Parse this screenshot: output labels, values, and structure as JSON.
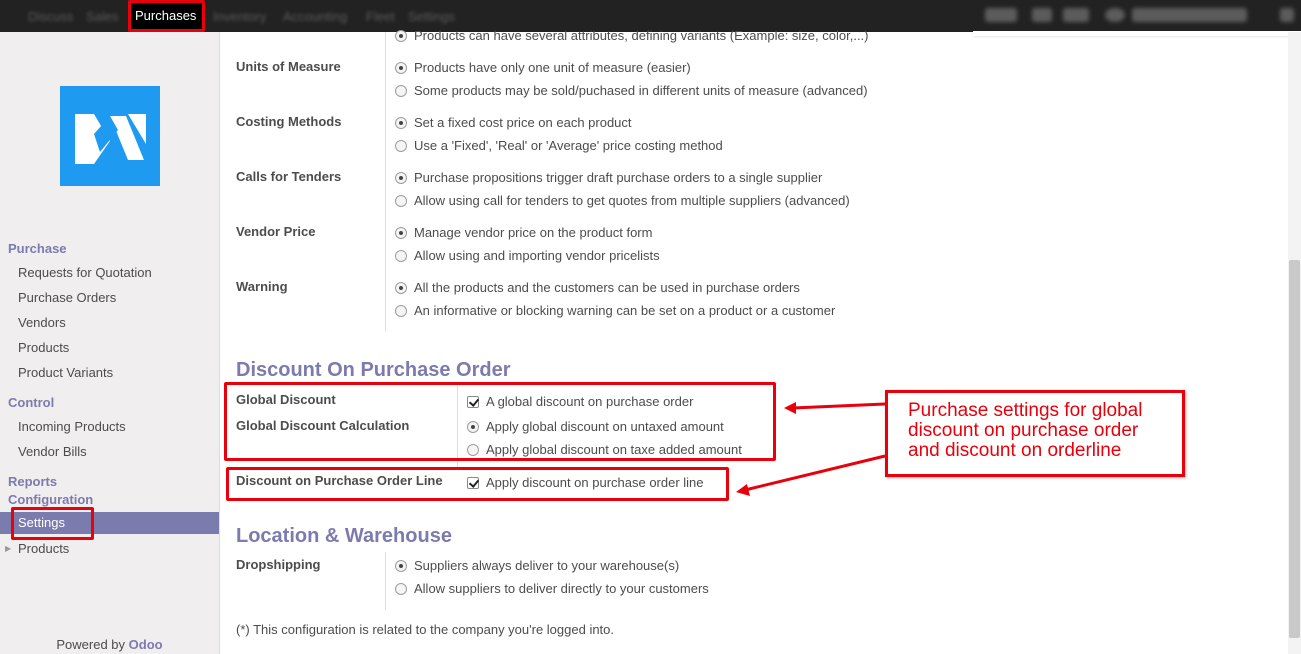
{
  "topbar": {
    "active_menu": "Purchases",
    "menu_blurred": [
      "Discuss",
      "Sales",
      "Inventory",
      "Accounting",
      "Fleet",
      "Settings"
    ]
  },
  "sidebar": {
    "sections": [
      {
        "title": "Purchase",
        "items": [
          "Requests for Quotation",
          "Purchase Orders",
          "Vendors",
          "Products",
          "Product Variants"
        ]
      },
      {
        "title": "Control",
        "items": [
          "Incoming Products",
          "Vendor Bills"
        ]
      },
      {
        "title": "Reports",
        "items": []
      },
      {
        "title": "Configuration",
        "items": [
          "Settings",
          "Products"
        ]
      }
    ],
    "powered_by": "Powered by",
    "brand": "Odoo"
  },
  "settings": {
    "variants_option": "Products can have several attributes, defining variants (Example: size, color,...)",
    "units": {
      "label": "Units of Measure",
      "options": [
        "Products have only one unit of measure (easier)",
        "Some products may be sold/puchased in different units of measure (advanced)"
      ],
      "selected": 0
    },
    "costing": {
      "label": "Costing Methods",
      "options": [
        "Set a fixed cost price on each product",
        "Use a 'Fixed', 'Real' or 'Average' price costing method"
      ],
      "selected": 0
    },
    "tenders": {
      "label": "Calls for Tenders",
      "options": [
        "Purchase propositions trigger draft purchase orders to a single supplier",
        "Allow using call for tenders to get quotes from multiple suppliers (advanced)"
      ],
      "selected": 0
    },
    "vendor_price": {
      "label": "Vendor Price",
      "options": [
        "Manage vendor price on the product form",
        "Allow using and importing vendor pricelists"
      ],
      "selected": 0
    },
    "warning": {
      "label": "Warning",
      "options": [
        "All the products and the customers can be used in purchase orders",
        "An informative or blocking warning can be set on a product or a customer"
      ],
      "selected": 0
    }
  },
  "discount": {
    "title": "Discount On Purchase Order",
    "global_label": "Global Discount",
    "global_option": "A global discount on purchase order",
    "global_checked": true,
    "calc_label": "Global Discount Calculation",
    "calc_options": [
      "Apply global discount on untaxed amount",
      "Apply global discount on taxe added amount"
    ],
    "calc_selected": 0,
    "line_label": "Discount on Purchase Order Line",
    "line_option": "Apply discount on purchase order line",
    "line_checked": true
  },
  "location": {
    "title": "Location & Warehouse",
    "dropship_label": "Dropshipping",
    "options": [
      "Suppliers always deliver to your warehouse(s)",
      "Allow suppliers to deliver directly to your customers"
    ],
    "selected": 0
  },
  "footnote": "(*) This configuration is related to the company you're logged into.",
  "annotation": {
    "lines": [
      "Purchase settings for global",
      "discount on purchase order",
      "and discount on orderline"
    ],
    "color": "#e8000b"
  }
}
